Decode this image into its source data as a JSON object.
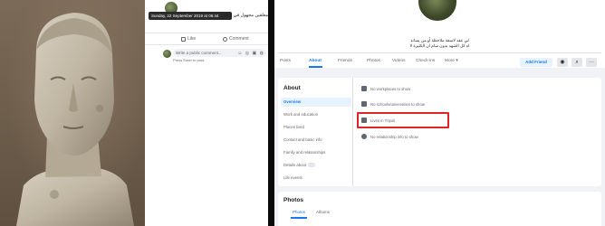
{
  "photo": {
    "subject_icon": "stone-bust-photo"
  },
  "post": {
    "author_name": "",
    "timestamp_tooltip": "Sunday, 22 September 2019 at 06:44",
    "text_preview": "معلقين مجهول في ديما",
    "like_label": "Like",
    "comment_label": "Comment",
    "comment_placeholder": "Write a public comment...",
    "comment_hint": "Press Enter to post.",
    "comment_emojis": "☺ ◎ ▣ ◍"
  },
  "profile": {
    "name": "",
    "bio_line1": "لي عقد لاسقة ملاحظة أو من يساند",
    "bio_line2": "اه كل الشهد بدون سام ان الكثيرة لا",
    "tabs": [
      "Posts",
      "About",
      "Friends",
      "Photos",
      "Videos",
      "Check-ins",
      "More ▾"
    ],
    "active_tab_index": 1,
    "add_friend_label": "Add Friend",
    "btn_message_icon": "messenger-icon",
    "btn_search_icon": "search-icon",
    "btn_more_icon": "more-icon"
  },
  "about": {
    "title": "About",
    "sections": [
      "Overview",
      "Work and education",
      "Places lived",
      "Contact and basic info",
      "Family and relationships",
      "Details about",
      "Life events"
    ],
    "active_section_index": 0,
    "overview_rows": [
      {
        "icon": "briefcase-icon",
        "text": "No workplaces to show"
      },
      {
        "icon": "graduation-cap-icon",
        "text": "No schools/universities to show"
      },
      {
        "icon": "home-icon",
        "text": "Lives in Tripoli"
      },
      {
        "icon": "location-pin-icon",
        "text": "No relationship info to show"
      }
    ]
  },
  "photos": {
    "title": "Photos",
    "tabs": [
      "Photos",
      "Albums"
    ],
    "active_tab_index": 0
  },
  "colors": {
    "accent": "#1877f2",
    "highlight": "#e02424",
    "page_bg": "#f0f2f5"
  }
}
